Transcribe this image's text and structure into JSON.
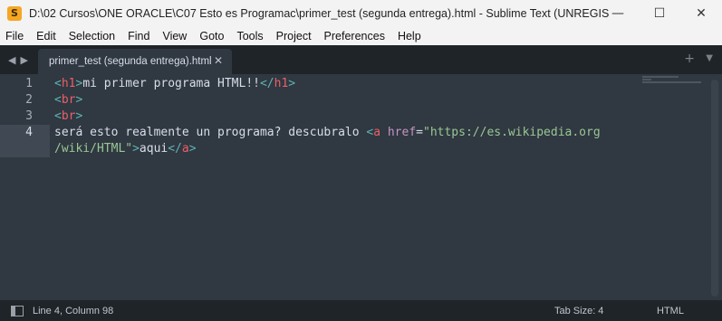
{
  "window": {
    "title": "D:\\02 Cursos\\ONE ORACLE\\C07 Esto es Programac\\primer_test (segunda entrega).html - Sublime Text (UNREGISTERE...",
    "minimize": "—",
    "maximize": "☐",
    "close": "✕"
  },
  "menu": [
    "File",
    "Edit",
    "Selection",
    "Find",
    "View",
    "Goto",
    "Tools",
    "Project",
    "Preferences",
    "Help"
  ],
  "tabbar": {
    "back": "◀",
    "forward": "▶",
    "active_tab": "primer_test (segunda entrega).html",
    "close": "✕",
    "new_tab": "+",
    "tab_list": "▼"
  },
  "editor": {
    "line_numbers": [
      "1",
      "2",
      "3",
      "4"
    ],
    "lines": {
      "l1": {
        "lt": "<",
        "tag": "h1",
        "gt": ">",
        "text": "mi primer programa HTML!!",
        "lt2": "</",
        "tag2": "h1",
        "gt2": ">"
      },
      "l2": {
        "lt": "<",
        "tag": "br",
        "gt": ">"
      },
      "l3": {
        "lt": "<",
        "tag": "br",
        "gt": ">"
      },
      "l4": {
        "text": "será esto realmente un programa? descubralo ",
        "lt": "<",
        "tag": "a",
        "attr": " href",
        "eq": "=",
        "str1": "\"https://es.wikipedia.org",
        "str2": "/wiki/HTML\"",
        "gt": ">",
        "text2": "aqui",
        "lt2": "</",
        "tag2": "a",
        "gt2": ">"
      }
    }
  },
  "status": {
    "position": "Line 4, Column 98",
    "tab_size": "Tab Size: 4",
    "syntax": "HTML"
  }
}
